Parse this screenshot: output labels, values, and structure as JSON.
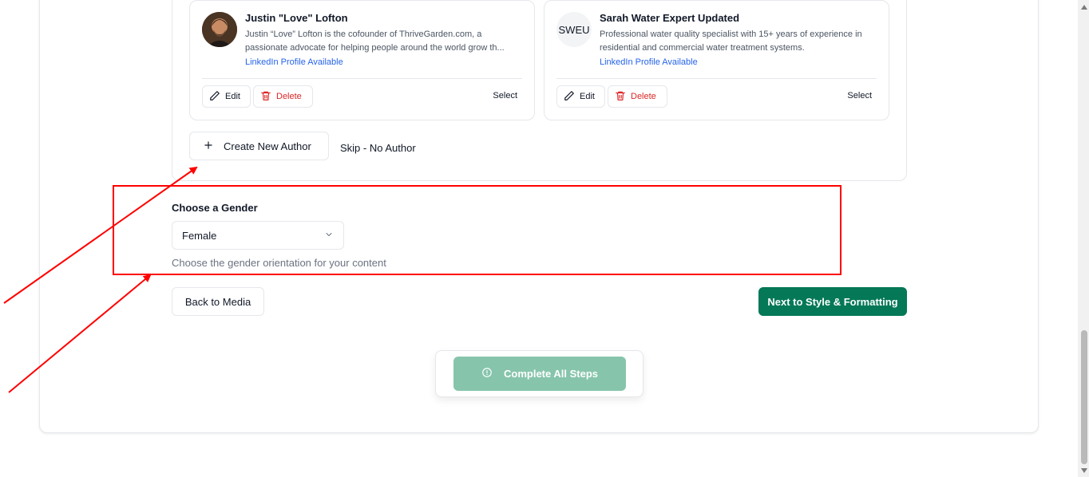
{
  "authors": [
    {
      "name": "Justin \"Love\" Lofton",
      "bio": "Justin “Love” Lofton is the cofounder of ThriveGarden.com, a passionate advocate for helping people around the world grow th...",
      "link": "LinkedIn Profile Available",
      "avatar": "photo",
      "edit_label": "Edit",
      "delete_label": "Delete",
      "select_label": "Select"
    },
    {
      "name": "Sarah Water Expert Updated",
      "initials": "SWEU",
      "bio": "Professional water quality specialist with 15+ years of experience in residential and commercial water treatment systems.",
      "link": "LinkedIn Profile Available",
      "edit_label": "Edit",
      "delete_label": "Delete",
      "select_label": "Select"
    }
  ],
  "actions": {
    "create_author": "Create New Author",
    "skip": "Skip - No Author"
  },
  "gender": {
    "label": "Choose a Gender",
    "selected": "Female",
    "hint": "Choose the gender orientation for your content"
  },
  "navigation": {
    "back": "Back to Media",
    "next": "Next to Style & Formatting",
    "complete": "Complete All Steps"
  },
  "colors": {
    "accent": "#047857",
    "accent_disabled": "#86c5ac",
    "danger": "#dc2626",
    "link": "#2563eb",
    "annotation": "#ff0000"
  },
  "icons": [
    "pencil-icon",
    "trash-icon",
    "plus-icon",
    "chevron-down-icon",
    "alert-circle-icon"
  ]
}
